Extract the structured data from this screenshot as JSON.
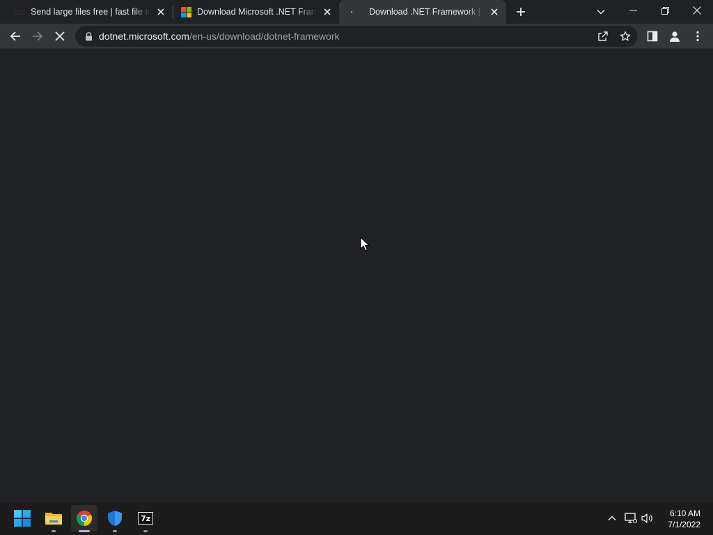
{
  "browser": {
    "tabs": [
      {
        "title": "Send large files free | fast file transfer",
        "favicon": "txl-favicon",
        "active": false
      },
      {
        "title": "Download Microsoft .NET Framework",
        "favicon": "microsoft-favicon",
        "active": false
      },
      {
        "title": "Download .NET Framework | Free",
        "favicon": "loading-favicon",
        "active": true
      }
    ],
    "new_tab_icon": "plus-icon",
    "tab_search_icon": "chevron-down-icon",
    "address": {
      "host": "dotnet.microsoft.com",
      "path": "/en-us/download/dotnet-framework"
    },
    "nav_icons": [
      "back-arrow-icon",
      "forward-arrow-icon",
      "stop-loading-icon"
    ],
    "omnibox_icons": [
      "share-icon",
      "bookmark-star-icon"
    ],
    "toolbar_icons": [
      "side-panel-icon",
      "profile-icon",
      "menu-dots-icon"
    ]
  },
  "taskbar": {
    "apps": [
      "windows-start-icon",
      "file-explorer-icon",
      "chrome-icon",
      "windows-security-icon",
      "7zip-icon"
    ],
    "sevenzip_label": "7z",
    "tray_icons": [
      "chevron-up-icon",
      "network-icon",
      "volume-icon"
    ],
    "time": "6:10 AM",
    "date": "7/1/2022"
  },
  "colors": {
    "page_background": "#202124",
    "toolbar": "#35363a",
    "taskbar": "#1c1c1c",
    "url_host": "#e8eaed",
    "url_path": "#9aa0a6"
  }
}
